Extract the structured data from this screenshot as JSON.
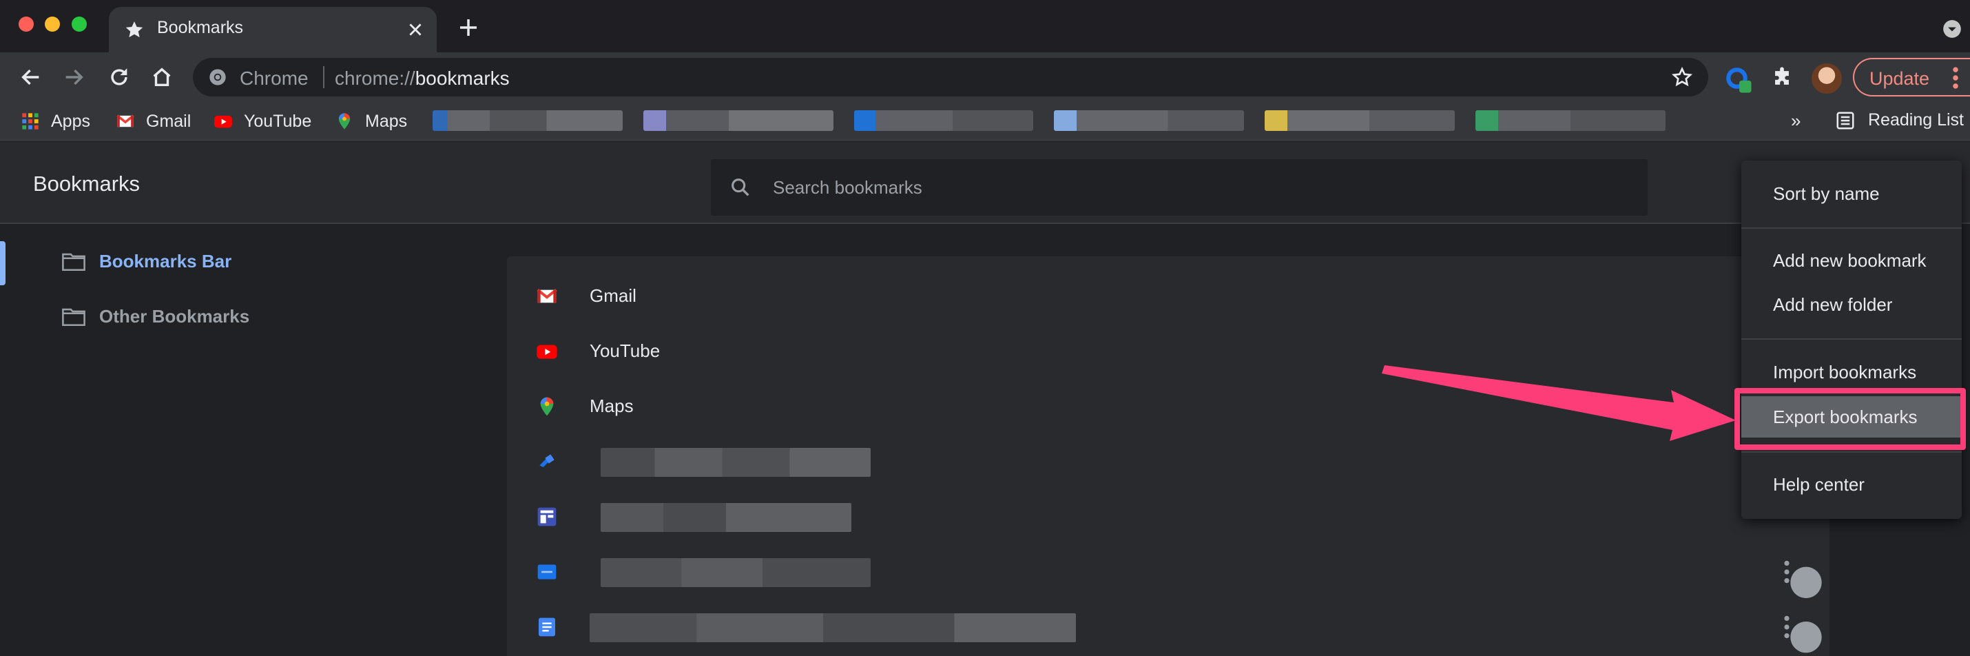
{
  "tab": {
    "title": "Bookmarks"
  },
  "omnibox": {
    "scheme": "Chrome",
    "url_prefix": "chrome://",
    "url_path": "bookmarks"
  },
  "toolbar": {
    "update_label": "Update"
  },
  "bookmarks_bar": {
    "items": [
      {
        "label": "Apps",
        "icon": "apps-grid-icon"
      },
      {
        "label": "Gmail",
        "icon": "gmail-icon"
      },
      {
        "label": "YouTube",
        "icon": "youtube-icon"
      },
      {
        "label": "Maps",
        "icon": "maps-icon"
      }
    ],
    "overflow": "»",
    "reading_list": "Reading List"
  },
  "manager": {
    "title": "Bookmarks",
    "search_placeholder": "Search bookmarks",
    "folders": [
      {
        "label": "Bookmarks Bar",
        "selected": true
      },
      {
        "label": "Other Bookmarks",
        "selected": false
      }
    ],
    "rows": [
      {
        "label": "Gmail",
        "icon": "gmail-icon"
      },
      {
        "label": "YouTube",
        "icon": "youtube-icon"
      },
      {
        "label": "Maps",
        "icon": "maps-icon"
      }
    ]
  },
  "menu": {
    "items": [
      {
        "label": "Sort by name"
      },
      {
        "label": "Add new bookmark"
      },
      {
        "label": "Add new folder"
      },
      {
        "label": "Import bookmarks"
      },
      {
        "label": "Export bookmarks",
        "highlighted": true
      },
      {
        "label": "Help center"
      }
    ]
  },
  "colors": {
    "annotation": "#fd3d78",
    "accent": "#8ab4f8",
    "update": "#f28b82"
  }
}
